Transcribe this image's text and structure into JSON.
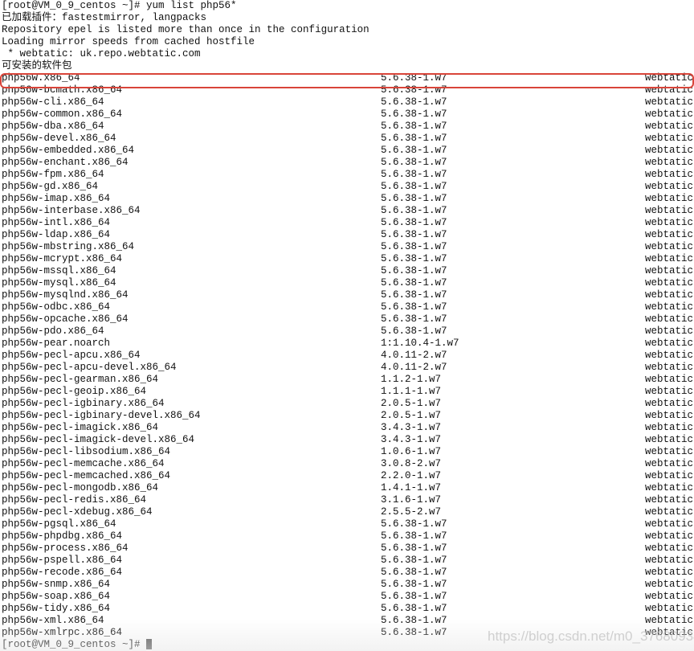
{
  "header_lines": [
    "[root@VM_0_9_centos ~]# yum list php56*",
    "已加载插件：fastestmirror, langpacks",
    "Repository epel is listed more than once in the configuration",
    "Loading mirror speeds from cached hostfile",
    " * webtatic: uk.repo.webtatic.com",
    "可安装的软件包"
  ],
  "packages": [
    [
      "php56w.x86_64",
      "5.6.38-1.w7",
      "webtatic"
    ],
    [
      "php56w-bcmath.x86_64",
      "5.6.38-1.w7",
      "webtatic"
    ],
    [
      "php56w-cli.x86_64",
      "5.6.38-1.w7",
      "webtatic"
    ],
    [
      "php56w-common.x86_64",
      "5.6.38-1.w7",
      "webtatic"
    ],
    [
      "php56w-dba.x86_64",
      "5.6.38-1.w7",
      "webtatic"
    ],
    [
      "php56w-devel.x86_64",
      "5.6.38-1.w7",
      "webtatic"
    ],
    [
      "php56w-embedded.x86_64",
      "5.6.38-1.w7",
      "webtatic"
    ],
    [
      "php56w-enchant.x86_64",
      "5.6.38-1.w7",
      "webtatic"
    ],
    [
      "php56w-fpm.x86_64",
      "5.6.38-1.w7",
      "webtatic"
    ],
    [
      "php56w-gd.x86_64",
      "5.6.38-1.w7",
      "webtatic"
    ],
    [
      "php56w-imap.x86_64",
      "5.6.38-1.w7",
      "webtatic"
    ],
    [
      "php56w-interbase.x86_64",
      "5.6.38-1.w7",
      "webtatic"
    ],
    [
      "php56w-intl.x86_64",
      "5.6.38-1.w7",
      "webtatic"
    ],
    [
      "php56w-ldap.x86_64",
      "5.6.38-1.w7",
      "webtatic"
    ],
    [
      "php56w-mbstring.x86_64",
      "5.6.38-1.w7",
      "webtatic"
    ],
    [
      "php56w-mcrypt.x86_64",
      "5.6.38-1.w7",
      "webtatic"
    ],
    [
      "php56w-mssql.x86_64",
      "5.6.38-1.w7",
      "webtatic"
    ],
    [
      "php56w-mysql.x86_64",
      "5.6.38-1.w7",
      "webtatic"
    ],
    [
      "php56w-mysqlnd.x86_64",
      "5.6.38-1.w7",
      "webtatic"
    ],
    [
      "php56w-odbc.x86_64",
      "5.6.38-1.w7",
      "webtatic"
    ],
    [
      "php56w-opcache.x86_64",
      "5.6.38-1.w7",
      "webtatic"
    ],
    [
      "php56w-pdo.x86_64",
      "5.6.38-1.w7",
      "webtatic"
    ],
    [
      "php56w-pear.noarch",
      "1:1.10.4-1.w7",
      "webtatic"
    ],
    [
      "php56w-pecl-apcu.x86_64",
      "4.0.11-2.w7",
      "webtatic"
    ],
    [
      "php56w-pecl-apcu-devel.x86_64",
      "4.0.11-2.w7",
      "webtatic"
    ],
    [
      "php56w-pecl-gearman.x86_64",
      "1.1.2-1.w7",
      "webtatic"
    ],
    [
      "php56w-pecl-geoip.x86_64",
      "1.1.1-1.w7",
      "webtatic"
    ],
    [
      "php56w-pecl-igbinary.x86_64",
      "2.0.5-1.w7",
      "webtatic"
    ],
    [
      "php56w-pecl-igbinary-devel.x86_64",
      "2.0.5-1.w7",
      "webtatic"
    ],
    [
      "php56w-pecl-imagick.x86_64",
      "3.4.3-1.w7",
      "webtatic"
    ],
    [
      "php56w-pecl-imagick-devel.x86_64",
      "3.4.3-1.w7",
      "webtatic"
    ],
    [
      "php56w-pecl-libsodium.x86_64",
      "1.0.6-1.w7",
      "webtatic"
    ],
    [
      "php56w-pecl-memcache.x86_64",
      "3.0.8-2.w7",
      "webtatic"
    ],
    [
      "php56w-pecl-memcached.x86_64",
      "2.2.0-1.w7",
      "webtatic"
    ],
    [
      "php56w-pecl-mongodb.x86_64",
      "1.4.1-1.w7",
      "webtatic"
    ],
    [
      "php56w-pecl-redis.x86_64",
      "3.1.6-1.w7",
      "webtatic"
    ],
    [
      "php56w-pecl-xdebug.x86_64",
      "2.5.5-2.w7",
      "webtatic"
    ],
    [
      "php56w-pgsql.x86_64",
      "5.6.38-1.w7",
      "webtatic"
    ],
    [
      "php56w-phpdbg.x86_64",
      "5.6.38-1.w7",
      "webtatic"
    ],
    [
      "php56w-process.x86_64",
      "5.6.38-1.w7",
      "webtatic"
    ],
    [
      "php56w-pspell.x86_64",
      "5.6.38-1.w7",
      "webtatic"
    ],
    [
      "php56w-recode.x86_64",
      "5.6.38-1.w7",
      "webtatic"
    ],
    [
      "php56w-snmp.x86_64",
      "5.6.38-1.w7",
      "webtatic"
    ],
    [
      "php56w-soap.x86_64",
      "5.6.38-1.w7",
      "webtatic"
    ],
    [
      "php56w-tidy.x86_64",
      "5.6.38-1.w7",
      "webtatic"
    ],
    [
      "php56w-xml.x86_64",
      "5.6.38-1.w7",
      "webtatic"
    ],
    [
      "php56w-xmlrpc.x86_64",
      "5.6.38-1.w7",
      "webtatic"
    ]
  ],
  "prompt": "[root@VM_0_9_centos ~]# ",
  "watermark": "https://blog.csdn.net/m0_37680934",
  "highlight_color": "#d9453a"
}
